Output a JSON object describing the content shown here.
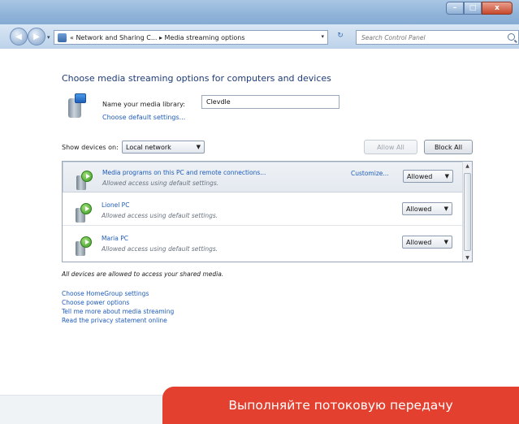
{
  "window": {
    "caption_buttons": [
      "–",
      "□",
      "x"
    ]
  },
  "nav": {
    "back_icon": "back-arrow-icon",
    "forward_icon": "forward-arrow-icon",
    "address_text": "« Network and Sharing C... ▸ Media streaming options",
    "search_placeholder": "Search Control Panel"
  },
  "page": {
    "title": "Choose media streaming options for computers and devices",
    "library_label": "Name your media library:",
    "library_name": "Clevdle",
    "default_settings_link": "Choose default settings...",
    "show_devices_label": "Show devices on:",
    "network_select": "Local network",
    "allow_all": "Allow All",
    "block_all": "Block All"
  },
  "devices": [
    {
      "name": "Media programs on this PC and remote connections...",
      "description": "Allowed access using default settings.",
      "customize": "Customize...",
      "status": "Allowed"
    },
    {
      "name": "Lionel PC",
      "description": "Allowed access using default settings.",
      "status": "Allowed"
    },
    {
      "name": "Maria PC",
      "description": "Allowed access using default settings.",
      "status": "Allowed"
    }
  ],
  "status_text": "All devices are allowed to access your shared media.",
  "links": [
    "Choose HomeGroup settings",
    "Choose power options",
    "Tell me more about media streaming",
    "Read the privacy statement online"
  ],
  "caption": "Выполняйте потоковую передачу",
  "colors": {
    "accent_link": "#1e5bb8",
    "title": "#1e3c78",
    "caption_bg": "#e3402f"
  }
}
